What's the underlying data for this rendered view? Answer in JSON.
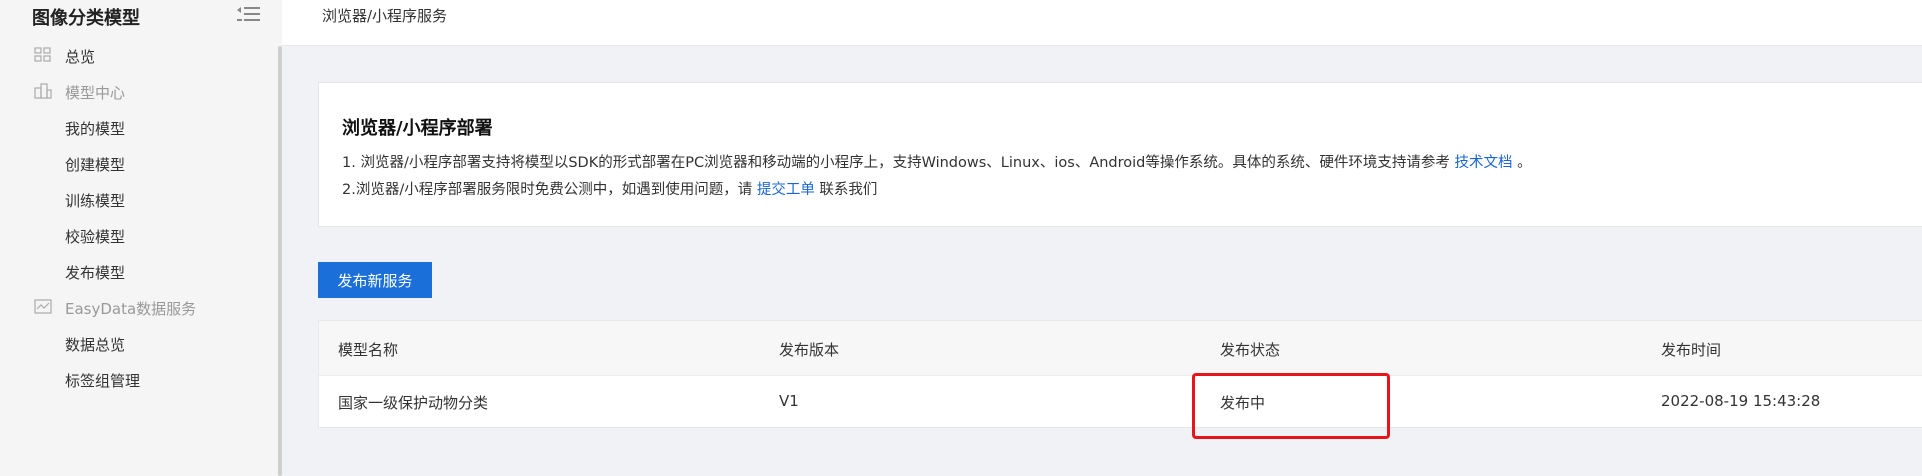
{
  "sidebar": {
    "title": "图像分类模型",
    "items": [
      {
        "label": "总览",
        "icon": "dashboard-icon",
        "group": false
      },
      {
        "label": "模型中心",
        "icon": "model-center-icon",
        "group": true
      },
      {
        "label": "我的模型",
        "group": false
      },
      {
        "label": "创建模型",
        "group": false
      },
      {
        "label": "训练模型",
        "group": false
      },
      {
        "label": "校验模型",
        "group": false
      },
      {
        "label": "发布模型",
        "group": false
      },
      {
        "label": "EasyData数据服务",
        "icon": "data-service-icon",
        "group": true
      },
      {
        "label": "数据总览",
        "group": false
      },
      {
        "label": "标签组管理",
        "group": false
      }
    ]
  },
  "breadcrumb": "浏览器/小程序服务",
  "info": {
    "title": "浏览器/小程序部署",
    "line1_pre": "1. 浏览器/小程序部署支持将模型以SDK的形式部署在PC浏览器和移动端的小程序上，支持Windows、Linux、ios、Android等操作系统。具体的系统、硬件环境支持请参考 ",
    "line1_link": "技术文档",
    "line1_post": " 。",
    "line2_pre": "2.浏览器/小程序部署服务限时免费公测中，如遇到使用问题，请 ",
    "line2_link": "提交工单",
    "line2_post": " 联系我们"
  },
  "publish_button": "发布新服务",
  "table": {
    "headers": [
      "模型名称",
      "发布版本",
      "发布状态",
      "发布时间"
    ],
    "rows": [
      [
        "国家一级保护动物分类",
        "V1",
        "发布中",
        "2022-08-19 15:43:28"
      ]
    ]
  },
  "colors": {
    "accent": "#1a6fd8",
    "link": "#1a66d6",
    "highlight": "#e8141c"
  }
}
